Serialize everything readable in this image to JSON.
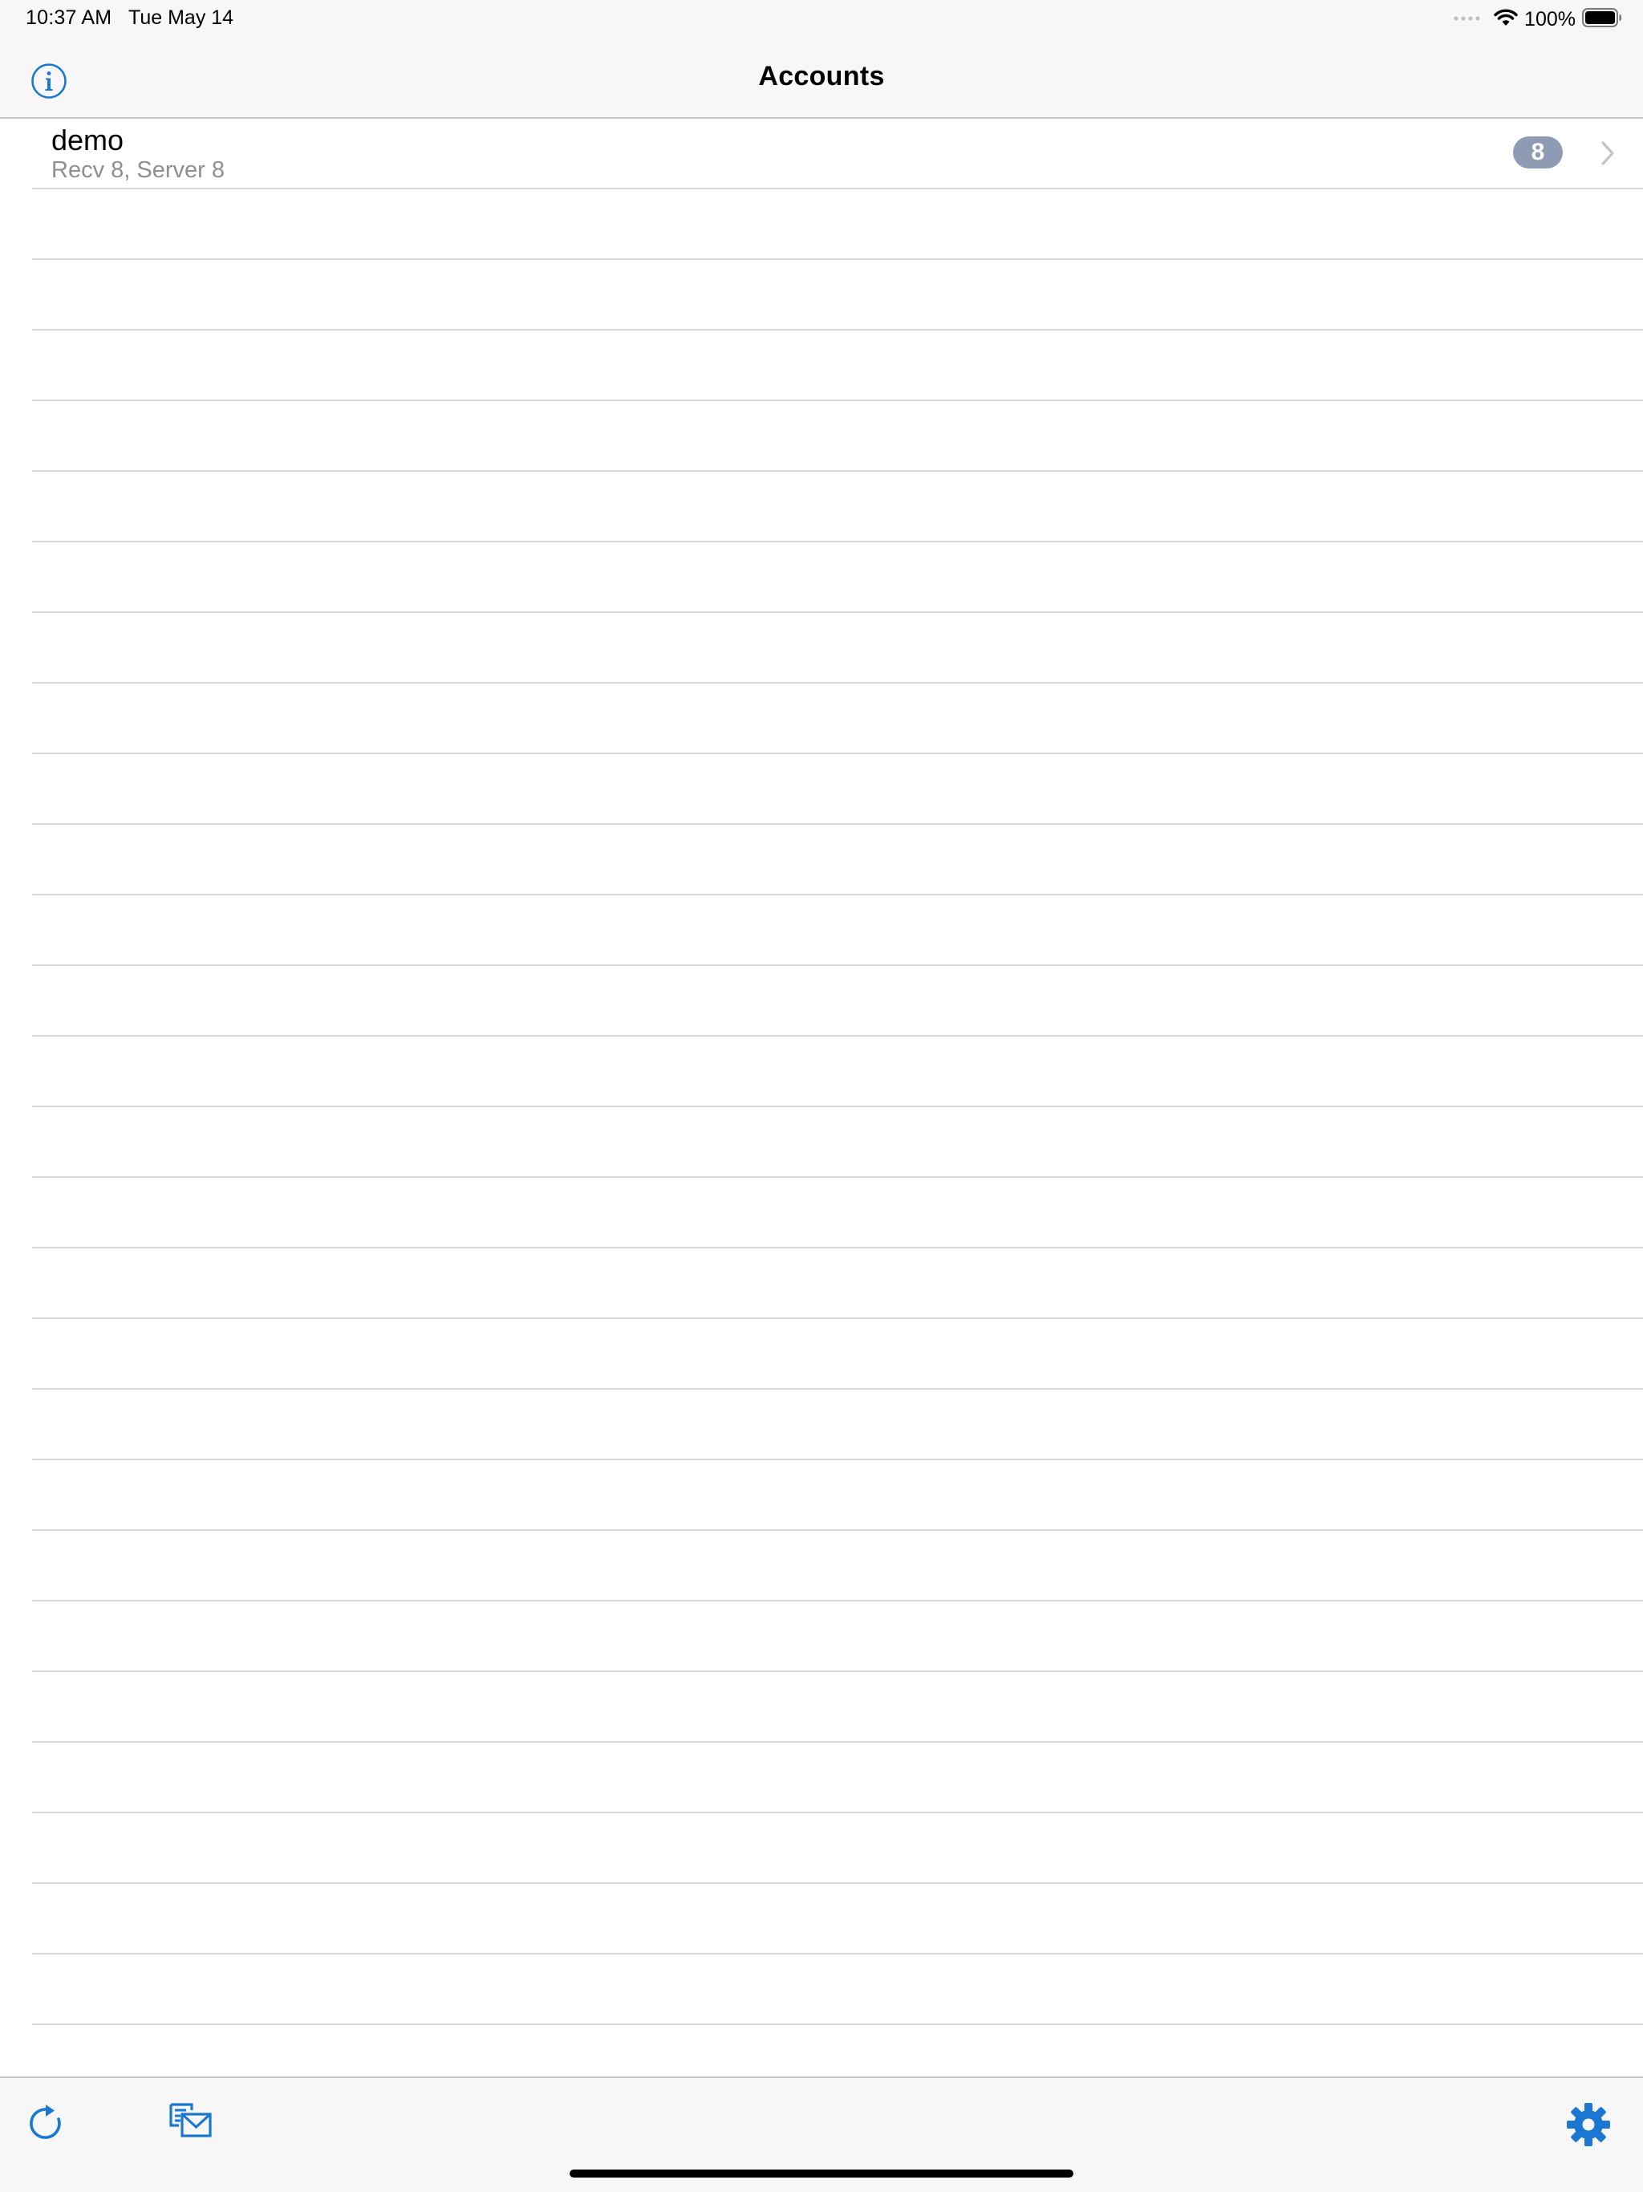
{
  "status_bar": {
    "time": "10:37 AM",
    "date": "Tue May 14",
    "battery": "100%",
    "icons": [
      "signal-dots-icon",
      "wifi-icon",
      "battery-icon"
    ]
  },
  "nav": {
    "title": "Accounts",
    "left_icon": "info-icon"
  },
  "accounts": [
    {
      "name": "demo",
      "detail": "Recv 8, Server 8",
      "badge": "8"
    }
  ],
  "toolbar": {
    "icons": [
      "refresh-icon",
      "compose-mail-icon",
      "gear-icon"
    ]
  },
  "colors": {
    "accent": "#1a78d2",
    "badge": "#8e9bb2",
    "bar_background": "#f7f7f7",
    "separator": "#d7d7db",
    "secondary_text": "#8e8e93"
  }
}
